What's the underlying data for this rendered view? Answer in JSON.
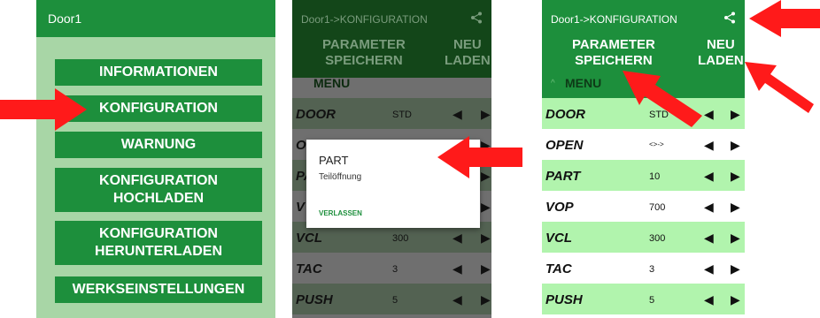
{
  "panel1": {
    "title": "Door1",
    "buttons": [
      {
        "label": "INFORMATIONEN"
      },
      {
        "label": "KONFIGURATION"
      },
      {
        "label": "WARNUNG"
      },
      {
        "label": "KONFIGURATION\nHOCHLADEN"
      },
      {
        "label": "KONFIGURATION\nHERUNTERLADEN"
      },
      {
        "label": "WERKSEINSTELLUNGEN"
      }
    ]
  },
  "panel2": {
    "title": "Door1->KONFIGURATION",
    "save_label": "PARAMETER\nSPEICHERN",
    "reload_label": "NEU\nLADEN",
    "menu_label": "MENU",
    "rows": [
      {
        "name": "DOOR",
        "value": "STD"
      },
      {
        "name": "OPEN",
        "value": ""
      },
      {
        "name": "PA",
        "value": ""
      },
      {
        "name": "V",
        "value": ""
      },
      {
        "name": "VCL",
        "value": "300"
      },
      {
        "name": "TAC",
        "value": "3"
      },
      {
        "name": "PUSH",
        "value": "5"
      }
    ],
    "dialog": {
      "title": "PART",
      "message": "Teilöffnung",
      "button": "VERLASSEN"
    }
  },
  "panel3": {
    "title": "Door1->KONFIGURATION",
    "save_label": "PARAMETER\nSPEICHERN",
    "reload_label": "NEU\nLADEN",
    "menu_label": "MENU",
    "rows": [
      {
        "name": "DOOR",
        "value": "STD"
      },
      {
        "name": "OPEN",
        "value": "<>->"
      },
      {
        "name": "PART",
        "value": "10"
      },
      {
        "name": "VOP",
        "value": "700"
      },
      {
        "name": "VCL",
        "value": "300"
      },
      {
        "name": "TAC",
        "value": "3"
      },
      {
        "name": "PUSH",
        "value": "5"
      }
    ]
  },
  "icons": {
    "share": "share-icon",
    "left": "left-triangle-icon",
    "right": "right-triangle-icon",
    "arrow": "red-arrow-icon",
    "chevron": "chevron-up-icon"
  },
  "colors": {
    "green": "#1d8f3c",
    "light_green": "#a8d6a6",
    "row_green": "#b1f4ad",
    "arrow_red": "#ff1a1a"
  }
}
